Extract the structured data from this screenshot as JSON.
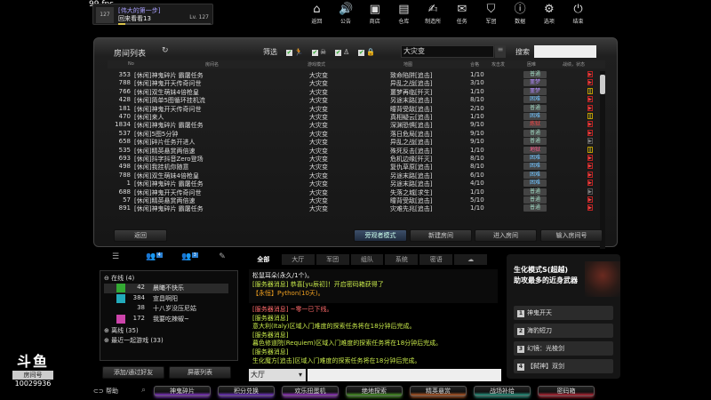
{
  "fps": "99 fps",
  "player": {
    "title": "[伟大的第一步]",
    "name": "回来看看13",
    "level": "Lv. 127",
    "badge": "127",
    "xp_fraction": 0.08
  },
  "nav": [
    {
      "icon": "home-icon",
      "glyph": "⌂",
      "label": "返回"
    },
    {
      "icon": "speaker-icon",
      "glyph": "🔊",
      "label": "公告"
    },
    {
      "icon": "shop-icon",
      "glyph": "▣",
      "label": "商店"
    },
    {
      "icon": "warehouse-icon",
      "glyph": "▤",
      "label": "仓库"
    },
    {
      "icon": "crafting-icon",
      "glyph": "✍",
      "label": "制造所"
    },
    {
      "icon": "mission-icon",
      "glyph": "✉",
      "label": "任务"
    },
    {
      "icon": "clan-icon",
      "glyph": "⛉",
      "label": "军团"
    },
    {
      "icon": "info-icon",
      "glyph": "ⓘ",
      "label": "数据"
    },
    {
      "icon": "gear-icon",
      "glyph": "⚙",
      "label": "选项"
    },
    {
      "icon": "power-icon",
      "glyph": "⏻",
      "label": "结束"
    }
  ],
  "room_list": {
    "title": "房间列表",
    "filter_label": "筛选",
    "mode_value": "大灾变",
    "search_label": "搜索",
    "search_value": "",
    "columns": [
      "No",
      "房间名",
      "游戏模式",
      "地图",
      "合格",
      "攻击发",
      "困难",
      "战绩，状态"
    ],
    "rows": [
      [
        "353",
        "[休闲]神鬼碎片 霸屠任务",
        "大灾变",
        "致命陷阱[追击]",
        "1/10",
        "普通",
        "play"
      ],
      [
        "788",
        "[休闲]神鬼开天传奇问世",
        "大灾变",
        "异乱之战[追击]",
        "3/10",
        "噩梦",
        "play"
      ],
      [
        "766",
        "[休闲]双生萌妹4倍枪皇",
        "大灾变",
        "噩梦再临[歼灭]",
        "1/10",
        "噩梦",
        "pause"
      ],
      [
        "428",
        "[休闲]简单5图循环挂机流",
        "大灾变",
        "另途末路[追击]",
        "8/10",
        "困难",
        "play"
      ],
      [
        "181",
        "[休闲]神鬼开天传奇问世",
        "大灾变",
        "瞳背受敌[追击]",
        "2/10",
        "普通",
        "play"
      ],
      [
        "470",
        "[休闲]来人",
        "大灾变",
        "真相疑云[追击]",
        "1/10",
        "困难",
        "pause"
      ],
      [
        "1834",
        "[休闲]神鬼碎片 霸屠任务",
        "大灾变",
        "深渊恐惧[追击]",
        "9/10",
        "炼狱",
        "play"
      ],
      [
        "537",
        "[休闲]5图5分钟",
        "大灾变",
        "落日危局[追击]",
        "9/10",
        "普通",
        "play"
      ],
      [
        "658",
        "[休闲]碎片任务开进人",
        "大灾变",
        "异乱之战[追击]",
        "9/10",
        "普通",
        "idle"
      ],
      [
        "535",
        "[休闲]精英悬赏两倍速",
        "大灾变",
        "殊死反击[追击]",
        "1/10",
        "地狱",
        "pause"
      ],
      [
        "693",
        "[休闲]抖字抖音Zero登场",
        "大灾变",
        "危机边缘[歼灭]",
        "8/10",
        "困难",
        "play"
      ],
      [
        "498",
        "[休闲]我挂机你随意",
        "大灾变",
        "复仇草原[追击]",
        "8/10",
        "困难",
        "play"
      ],
      [
        "788",
        "[休闲]双生萌妹4倍枪皇",
        "大灾变",
        "另途末路[追击]",
        "6/10",
        "困难",
        "play"
      ],
      [
        "1",
        "[休闲]神鬼碎片 霸屠任务",
        "大灾变",
        "另途末路[追击]",
        "4/10",
        "困难",
        "play"
      ],
      [
        "688",
        "[休闲]神鬼开天传奇问世",
        "大灾变",
        "失落之城[求生]",
        "1/10",
        "普通",
        "idle"
      ],
      [
        "57",
        "[休闲]精英悬赏两倍速",
        "大灾变",
        "瞳背受敌[追击]",
        "5/10",
        "普通",
        "play"
      ],
      [
        "891",
        "[休闲]神鬼碎片 霸屠任务",
        "大灾变",
        "灾难先兆[追击]",
        "1/10",
        "普通",
        "play"
      ]
    ],
    "difficulty_colors": {
      "普通": "#9fd6c0",
      "噩梦": "#b48cff",
      "困难": "#6fc3ff",
      "炼狱": "#ff4444",
      "地狱": "#ff5a8a"
    },
    "buttons": {
      "back": "返回",
      "observer": "旁观者模式",
      "create": "新建房间",
      "enter": "进入房间",
      "enter_number": "输入房间号"
    }
  },
  "friends": {
    "badges": [
      "4",
      "3"
    ],
    "groups": {
      "online": "在线 (4)",
      "offline": "离线 (35)",
      "recent": "最近一起游戏 (33)"
    },
    "list": [
      {
        "level": "42",
        "name": "晨曦不快乐"
      },
      {
        "level": "384",
        "name": "宣昌啊阳"
      },
      {
        "level": "38",
        "name": "十八岁没压尼姑"
      },
      {
        "level": "172",
        "name": "我要吃辣椒~"
      }
    ],
    "add_button": "添加/通过好友",
    "block_button": "屏蔽列表"
  },
  "chat": {
    "tabs": [
      "全部",
      "大厅",
      "军团",
      "组队",
      "系统",
      "密语"
    ],
    "system": [
      "松鼠耳朵(永久/1个)。",
      "[服务器消息] 恭喜[yu辰初]！开启密码箱获得了",
      "【永恒】Python(10天)。"
    ],
    "log": [
      "[服务器消息] ~零一已下线。",
      "[服务器消息]",
      "意大利(Italy)区域入门难度的探索任务将在18分钟后完成。",
      "[服务器消息]",
      "暮色修道院(Requiem)区域入门难度的探索任务将在18分钟后完成。",
      "[服务器消息]",
      "生化魔方[追击]区域入门难度的探索任务将在18分钟后完成。"
    ],
    "channel": "大厅",
    "input": ""
  },
  "event": {
    "title1": "生化模式S(超越)",
    "title2": "助攻最多的近身武器",
    "items": [
      {
        "n": "1",
        "label": "神鬼开天"
      },
      {
        "n": "2",
        "label": "海豹短刀"
      },
      {
        "n": "3",
        "label": "幻镜：光棱剑"
      },
      {
        "n": "4",
        "label": "【弑神】双剑"
      }
    ]
  },
  "stream": {
    "logo": "斗鱼",
    "room_label": "房间号",
    "room_id": "10029936"
  },
  "bottom": {
    "help": "帮助",
    "buttons": [
      {
        "label": "神鬼碎片",
        "color": "#8a3ad0"
      },
      {
        "label": "积分兑换",
        "color": "#7a3ad0"
      },
      {
        "label": "欢乐扭蛋机",
        "color": "#a03ad0"
      },
      {
        "label": "绝地探索",
        "color": "#4fa02a"
      },
      {
        "label": "精英悬赏",
        "color": "#c0602a"
      },
      {
        "label": "战场补给",
        "color": "#2aa08a"
      },
      {
        "label": "密码箱",
        "color": "#c02a3a"
      }
    ]
  }
}
